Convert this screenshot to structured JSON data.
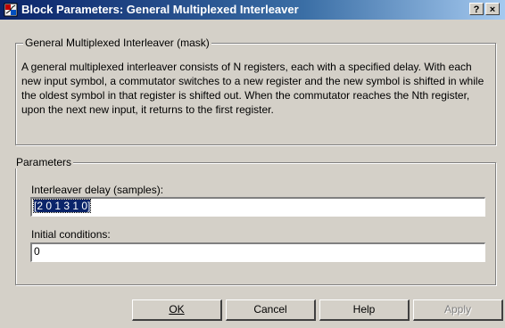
{
  "window": {
    "title": "Block Parameters: General Multiplexed Interleaver",
    "help_glyph": "?",
    "close_glyph": "×"
  },
  "mask": {
    "legend": "General Multiplexed Interleaver (mask)",
    "description": "A general multiplexed interleaver consists of N registers, each with a specified delay. With each new input symbol, a commutator switches to a new register and the new symbol is shifted in while the oldest symbol in that register is shifted out.  When the commutator reaches the Nth register, upon the next new input, it returns to the first register."
  },
  "parameters": {
    "legend": "Parameters",
    "delay_label": "Interleaver delay (samples):",
    "delay_value": "[2 0 1 3 1 0]",
    "ic_label": "Initial conditions:",
    "ic_value": "0"
  },
  "buttons": {
    "ok": "OK",
    "cancel": "Cancel",
    "help": "Help",
    "apply": "Apply"
  },
  "colors": {
    "face": "#d4d0c8",
    "title_start": "#0a246a",
    "title_end": "#a6caf0",
    "selection": "#0a246a"
  }
}
